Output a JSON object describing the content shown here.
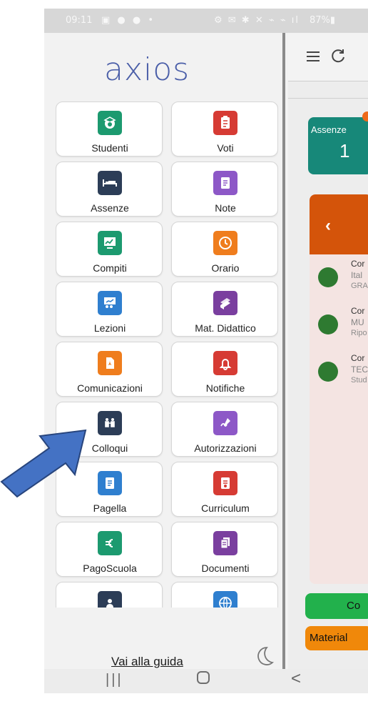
{
  "status_bar": {
    "time": "09:11",
    "left_icons": "▣ ● ● •",
    "right_icons": "⚙ ✉ ✱ ✕ ⌁ ⌁ ıl",
    "battery": "87%▮"
  },
  "drawer": {
    "logo_text": "axios",
    "guide_link": "Vai alla guida",
    "theme_toggle_icon": "moon-icon",
    "items": [
      {
        "label": "Studenti",
        "icon": "student-icon",
        "color": "#1c9a6f",
        "glyph": "🎓"
      },
      {
        "label": "Voti",
        "icon": "grades-icon",
        "color": "#d63b34",
        "glyph": "✎"
      },
      {
        "label": "Assenze",
        "icon": "bed-icon",
        "color": "#2c3d57",
        "glyph": "🛏"
      },
      {
        "label": "Note",
        "icon": "note-icon",
        "color": "#8d58c7",
        "glyph": "🗒"
      },
      {
        "label": "Compiti",
        "icon": "chart-board-icon",
        "color": "#1c9a6f",
        "glyph": "📈"
      },
      {
        "label": "Orario",
        "icon": "clock-icon",
        "color": "#ef7d1d",
        "glyph": "◷"
      },
      {
        "label": "Lezioni",
        "icon": "lesson-icon",
        "color": "#2f7fcf",
        "glyph": "👨‍🏫"
      },
      {
        "label": "Mat. Didattico",
        "icon": "books-icon",
        "color": "#7a3f9f",
        "glyph": "📚"
      },
      {
        "label": "Comunicazioni",
        "icon": "pdf-icon",
        "color": "#ef7d1d",
        "glyph": "⛶"
      },
      {
        "label": "Notifiche",
        "icon": "bell-icon",
        "color": "#d63b34",
        "glyph": "🔔"
      },
      {
        "label": "Colloqui",
        "icon": "meeting-icon",
        "color": "#2c3d57",
        "glyph": "👥"
      },
      {
        "label": "Autorizzazioni",
        "icon": "signature-icon",
        "color": "#8d58c7",
        "glyph": "✍"
      },
      {
        "label": "Pagella",
        "icon": "report-card-icon",
        "color": "#2f7fcf",
        "glyph": "▤"
      },
      {
        "label": "Curriculum",
        "icon": "certificate-icon",
        "color": "#d63b34",
        "glyph": "▣"
      },
      {
        "label": "PagoScuola",
        "icon": "euro-icon",
        "color": "#1c9a6f",
        "glyph": "€"
      },
      {
        "label": "Documenti",
        "icon": "documents-icon",
        "color": "#7a3f9f",
        "glyph": "🗎"
      },
      {
        "label": "",
        "icon": "profile-icon",
        "color": "#2c3d57",
        "glyph": "👤"
      },
      {
        "label": "",
        "icon": "globe-icon",
        "color": "#2f7fcf",
        "glyph": "🌐"
      }
    ]
  },
  "main": {
    "topbar": {
      "menu_icon": "hamburger-icon",
      "refresh_icon": "refresh-icon"
    },
    "absences_card": {
      "label": "Assenze",
      "value": "1"
    },
    "list_card": {
      "back_icon": "chevron-left-icon",
      "items": [
        {
          "line1": "Cor",
          "line2": "Ital",
          "line3": "GRA"
        },
        {
          "line1": "Cor",
          "line2": "MU",
          "line3": "Ripo"
        },
        {
          "line1": "Cor",
          "line2": "TEC",
          "line3": "Stud"
        }
      ]
    },
    "buttons": {
      "green": "Co",
      "orange": "Material"
    }
  },
  "nav_bar": {
    "recent": "|||",
    "back": "<"
  },
  "overlay": {
    "arrow_color": "#4472c4"
  }
}
